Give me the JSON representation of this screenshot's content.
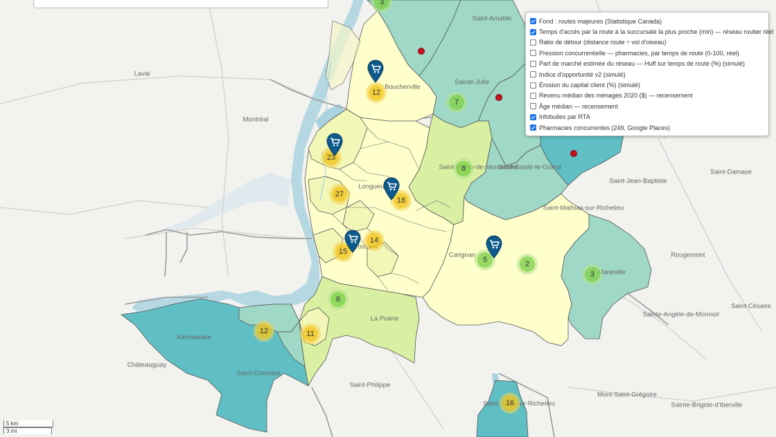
{
  "map": {
    "layers_title": "",
    "layers": [
      {
        "label": "Fond : routes majeures (Statistique Canada)",
        "checked": true
      },
      {
        "label": "Temps d'accès par la route à la succursale la plus proche (min) — réseau routier réel",
        "checked": true
      },
      {
        "label": "Ratio de détour (distance route ÷ vol d'oiseau)",
        "checked": false
      },
      {
        "label": "Pression concurrentielle — pharmacies, par temps de route (0-100, réel)",
        "checked": false
      },
      {
        "label": "Part de marché estimée du réseau — Huff sur temps de route (%) (simulé)",
        "checked": false
      },
      {
        "label": "Indice d'opportunité v2 (simulé)",
        "checked": false
      },
      {
        "label": "Érosion du capital client (%) (simulé)",
        "checked": false
      },
      {
        "label": "Revenu médian des ménages 2020 ($) — recensement",
        "checked": false
      },
      {
        "label": "Âge médian — recensement",
        "checked": false
      },
      {
        "label": "Infobulles par RTA",
        "checked": true
      },
      {
        "label": "Pharmacies concurrentes (249, Google Places)",
        "checked": true
      }
    ],
    "place_labels": [
      {
        "name": "Laval"
      },
      {
        "name": "Montréal"
      },
      {
        "name": "Boucherville"
      },
      {
        "name": "Sainte-Julie"
      },
      {
        "name": "Saint-Amable"
      },
      {
        "name": "Saint-Bruno-de-Montarville"
      },
      {
        "name": "Saint-Basile-le-Grand"
      },
      {
        "name": "Longueuil"
      },
      {
        "name": "Brossard"
      },
      {
        "name": "Carignan"
      },
      {
        "name": "Saint-Mathias-sur-Richelieu"
      },
      {
        "name": "Saint-Jean-Baptiste"
      },
      {
        "name": "Saint-Damase"
      },
      {
        "name": "Rougemont"
      },
      {
        "name": "Marieville"
      },
      {
        "name": "Saint-Césaire"
      },
      {
        "name": "Sainte-Angèle-de-Monnoir"
      },
      {
        "name": "La Prairie"
      },
      {
        "name": "Kahnawake"
      },
      {
        "name": "Châteauguay"
      },
      {
        "name": "Saint-Constant"
      },
      {
        "name": "Saint-Philippe"
      },
      {
        "name": "Saint-Jean-sur-Richelieu"
      },
      {
        "name": "Mont-Saint-Grégoire"
      },
      {
        "name": "Sainte-Brigide-d'Iberville"
      }
    ],
    "clusters": [
      {
        "count": "3",
        "color": "green"
      },
      {
        "count": "12",
        "color": "yellow"
      },
      {
        "count": "7",
        "color": "green"
      },
      {
        "count": "23",
        "color": "yellow"
      },
      {
        "count": "8",
        "color": "green"
      },
      {
        "count": "27",
        "color": "yellow"
      },
      {
        "count": "18",
        "color": "yellow"
      },
      {
        "count": "14",
        "color": "yellow"
      },
      {
        "count": "15",
        "color": "yellow"
      },
      {
        "count": "5",
        "color": "green"
      },
      {
        "count": "2",
        "color": "green"
      },
      {
        "count": "3",
        "color": "green"
      },
      {
        "count": "6",
        "color": "green"
      },
      {
        "count": "12",
        "color": "yellow"
      },
      {
        "count": "11",
        "color": "yellow"
      },
      {
        "count": "16",
        "color": "yellow"
      }
    ],
    "branch_markers_icon": "shopping-cart-icon",
    "scale": {
      "metric": "5 km",
      "imperial": "3 mi"
    },
    "colors": {
      "very_near": "#ffffcc",
      "near": "#d9f0a3",
      "mid": "#addd8e",
      "far": "#9fd8c7",
      "very_far": "#5fbfc4",
      "pin": "#0d5a8c",
      "competitor": "#c8101e"
    }
  }
}
